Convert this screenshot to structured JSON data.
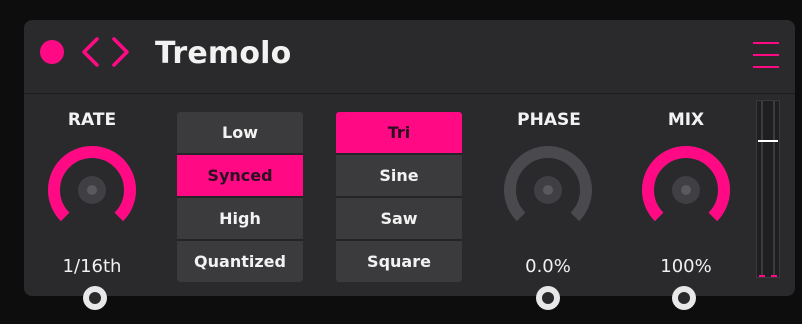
{
  "app": {
    "title": "Tremolo",
    "menu_icon": "hamburger-menu-icon"
  },
  "colors": {
    "accent": "#ff0a84",
    "panel": "#2a2a2d",
    "button": "#3b3b3e",
    "knob_track": "#4a4a4e"
  },
  "rate": {
    "label": "RATE",
    "value": "1/16th",
    "level": 1.0
  },
  "sync_modes": {
    "options": [
      "Low",
      "Synced",
      "High",
      "Quantized"
    ],
    "selected": "Synced"
  },
  "waveforms": {
    "options": [
      "Tri",
      "Sine",
      "Saw",
      "Square"
    ],
    "selected": "Tri"
  },
  "phase": {
    "label": "PHASE",
    "value": "0.0%",
    "level": 0.0
  },
  "mix": {
    "label": "MIX",
    "value": "100%",
    "level": 1.0
  },
  "meter": {
    "fader_level": 0.78,
    "output_level": 0.01
  }
}
